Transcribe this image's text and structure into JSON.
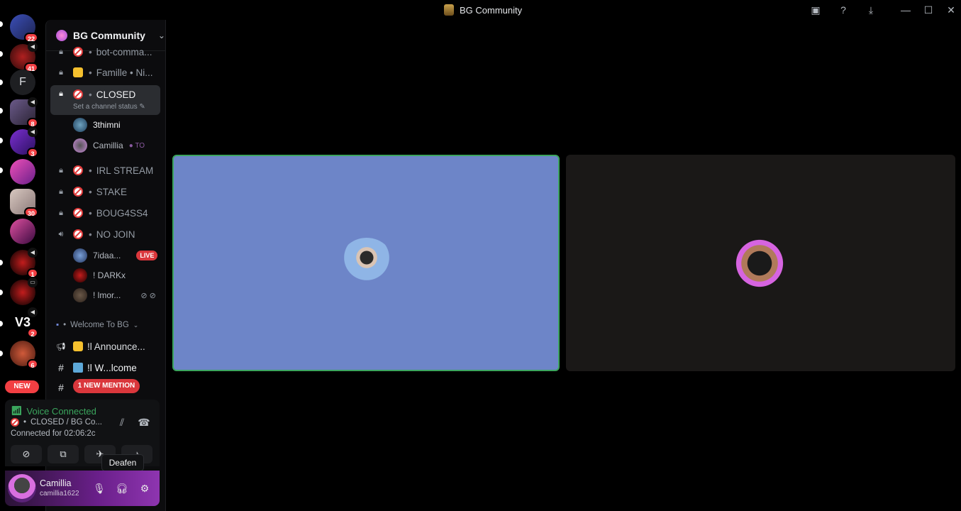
{
  "window": {
    "title": "BG Community"
  },
  "servers": [
    {
      "badge": "22"
    },
    {
      "badge": "41"
    },
    {
      "letter": "F"
    },
    {
      "badge": "8"
    },
    {
      "badge": "3"
    },
    {
      "badge": ""
    },
    {
      "badge": "30"
    },
    {
      "badge": ""
    },
    {
      "badge": "1"
    },
    {
      "badge": ""
    },
    {
      "badge": "2"
    },
    {
      "badge": "6"
    }
  ],
  "rail": {
    "new_label": "NEW"
  },
  "server": {
    "name": "BG Community"
  },
  "channels": {
    "partial_top": "bot-comma...",
    "famille": "Famille • Ni...",
    "closed": "CLOSED",
    "closed_status": "Set a channel status",
    "irl": "IRL STREAM",
    "stake": "STAKE",
    "boug": "BOUG4SS4",
    "nojoin": "NO JOIN",
    "welcome_category": "Welcome To BG",
    "announce": "ǃl Announce...",
    "welcome": "ǃl W...lcome",
    "mention_label": "1 NEW MENTION"
  },
  "closed_members": [
    "3thimni",
    "Camillia"
  ],
  "closed_member_tag": "TO",
  "nojoin_members": [
    "7idaa...",
    "! DARKx",
    "! lmor..."
  ],
  "live_label": "LIVE",
  "voice": {
    "status": "Voice Connected",
    "channel": "CLOSED / BG Co...",
    "duration": "Connected for 02:06:2с"
  },
  "user": {
    "display_name": "Camillia",
    "username": "camillia1622"
  },
  "tooltip": "Deafen",
  "colors": {
    "accent_green": "#3ba55d",
    "mention_red": "#da373c",
    "tile_blue": "#6d85c8"
  }
}
